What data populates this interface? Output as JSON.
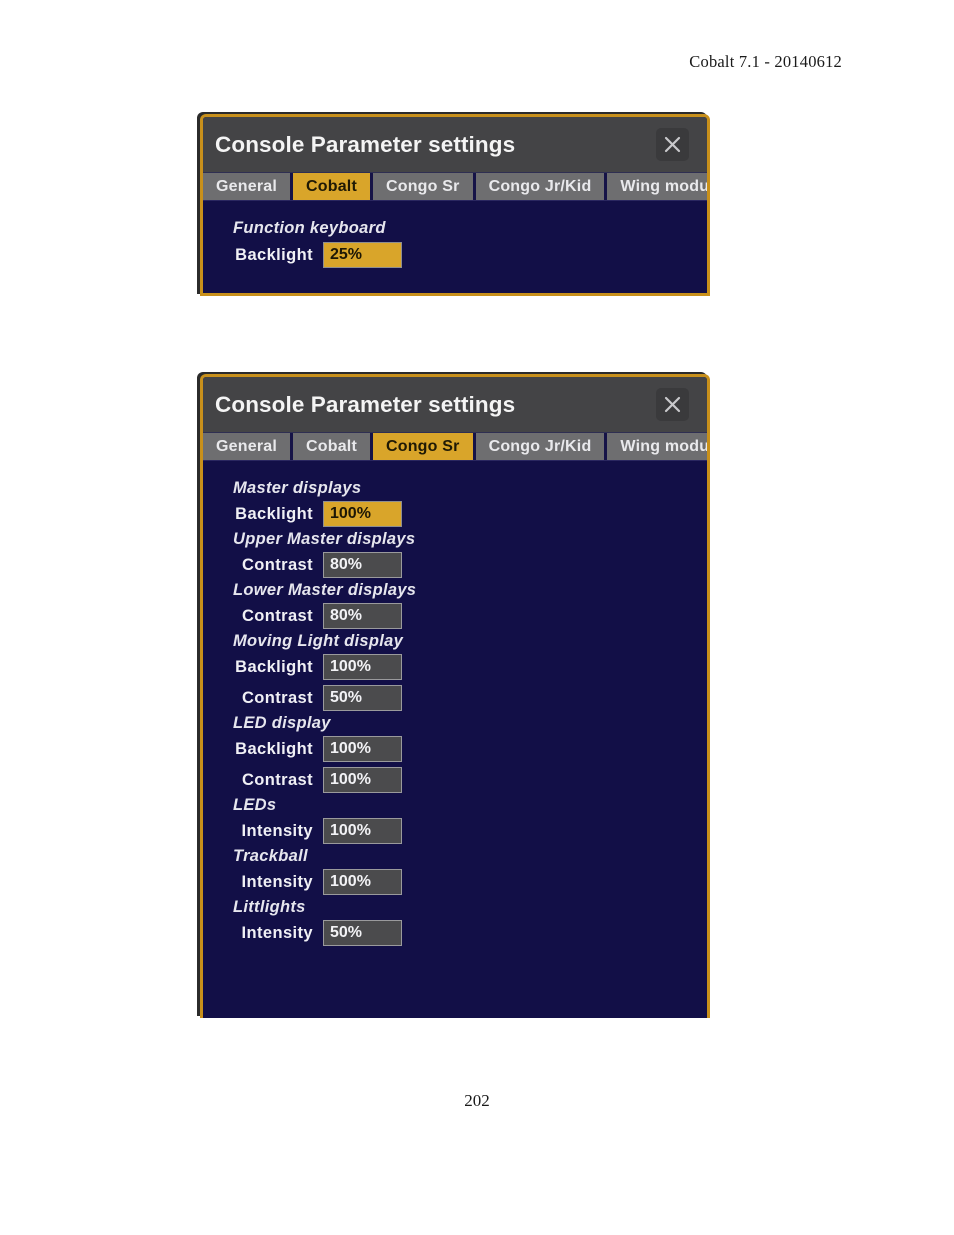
{
  "document": {
    "header": "Cobalt 7.1 - 20140612",
    "page_number": "202"
  },
  "colors": {
    "dialog_border": "#c8901b",
    "dialog_body": "#120f47",
    "titlebar": "#444446",
    "tab_inactive": "#6e6e70",
    "tab_active": "#d9a52a",
    "field_inactive": "#4b4b4d",
    "field_active": "#d9a52a"
  },
  "dialog_cobalt": {
    "title": "Console Parameter settings",
    "close_icon": "close-icon",
    "tabs": [
      {
        "label": "General",
        "selected": false
      },
      {
        "label": "Cobalt",
        "selected": true
      },
      {
        "label": "Congo Sr",
        "selected": false
      },
      {
        "label": "Congo Jr/Kid",
        "selected": false
      },
      {
        "label": "Wing modules",
        "selected": false
      }
    ],
    "groups": [
      {
        "title": "Function keyboard",
        "fields": [
          {
            "label": "Backlight",
            "value": "25%",
            "selected": true
          }
        ]
      }
    ]
  },
  "dialog_congo_sr": {
    "title": "Console Parameter settings",
    "close_icon": "close-icon",
    "tabs": [
      {
        "label": "General",
        "selected": false
      },
      {
        "label": "Cobalt",
        "selected": false
      },
      {
        "label": "Congo Sr",
        "selected": true
      },
      {
        "label": "Congo Jr/Kid",
        "selected": false
      },
      {
        "label": "Wing modules",
        "selected": false
      }
    ],
    "groups": [
      {
        "title": "Master displays",
        "fields": [
          {
            "label": "Backlight",
            "value": "100%",
            "selected": true
          }
        ]
      },
      {
        "title": "Upper Master displays",
        "fields": [
          {
            "label": "Contrast",
            "value": "80%",
            "selected": false
          }
        ]
      },
      {
        "title": "Lower Master displays",
        "fields": [
          {
            "label": "Contrast",
            "value": "80%",
            "selected": false
          }
        ]
      },
      {
        "title": "Moving Light display",
        "fields": [
          {
            "label": "Backlight",
            "value": "100%",
            "selected": false
          },
          {
            "label": "Contrast",
            "value": "50%",
            "selected": false
          }
        ]
      },
      {
        "title": "LED display",
        "fields": [
          {
            "label": "Backlight",
            "value": "100%",
            "selected": false
          },
          {
            "label": "Contrast",
            "value": "100%",
            "selected": false
          }
        ]
      },
      {
        "title": "LEDs",
        "fields": [
          {
            "label": "Intensity",
            "value": "100%",
            "selected": false
          }
        ]
      },
      {
        "title": "Trackball",
        "fields": [
          {
            "label": "Intensity",
            "value": "100%",
            "selected": false
          }
        ]
      },
      {
        "title": "Littlights",
        "fields": [
          {
            "label": "Intensity",
            "value": "50%",
            "selected": false
          }
        ]
      }
    ]
  }
}
